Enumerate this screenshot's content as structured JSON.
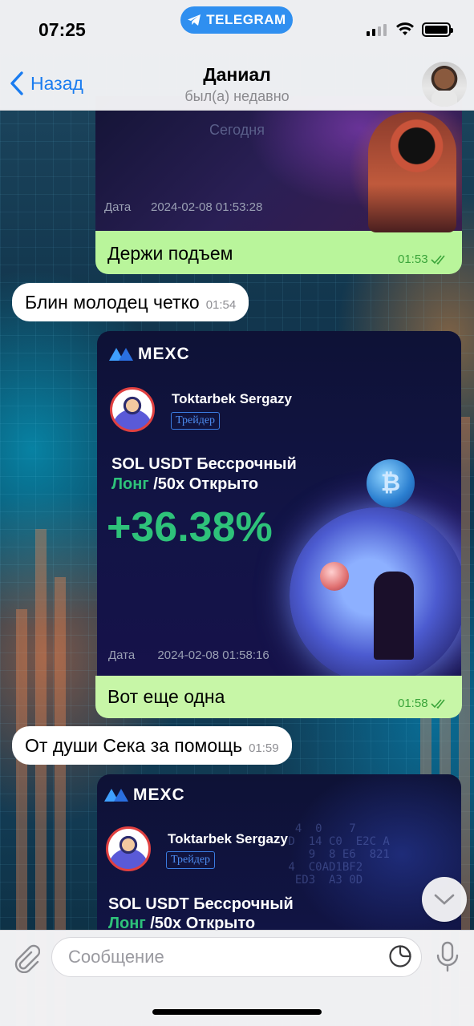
{
  "status": {
    "time": "07:25",
    "app_pill": "TELEGRAM"
  },
  "header": {
    "back_label": "Назад",
    "name": "Даниал",
    "subtitle": "был(а) недавно"
  },
  "messages": {
    "m1": {
      "overlay_text": "Сегодня",
      "date_label": "Дата",
      "date_value": "2024-02-08 01:53:28",
      "caption": "Держи подъем",
      "time": "01:53"
    },
    "m2": {
      "text": "Блин молодец четко",
      "time": "01:54"
    },
    "m3": {
      "brand": "MEXC",
      "trader_name": "Toktarbek Sergazy",
      "trader_badge": "Трейдер",
      "pair_line": "SOL USDT Бессрочный",
      "side": "Лонг",
      "leverage": "/50x Открыто",
      "pnl": "+36.38%",
      "date_label": "Дата",
      "date_value": "2024-02-08 01:58:16",
      "caption": "Вот еще одна",
      "time": "01:58"
    },
    "m4": {
      "text": "От души Сека за помощь",
      "time": "01:59"
    },
    "m5": {
      "brand": "MEXC",
      "trader_name": "Toktarbek Sergazy",
      "trader_badge": "Трейдер",
      "pair_line": "SOL USDT Бессрочный",
      "side": "Лонг",
      "leverage": "/50x Открыто"
    }
  },
  "composer": {
    "placeholder": "Сообщение"
  },
  "colors": {
    "accent": "#1a7cf0",
    "outgoing": "#c7f6a7",
    "pnl_green": "#2ec27a"
  }
}
